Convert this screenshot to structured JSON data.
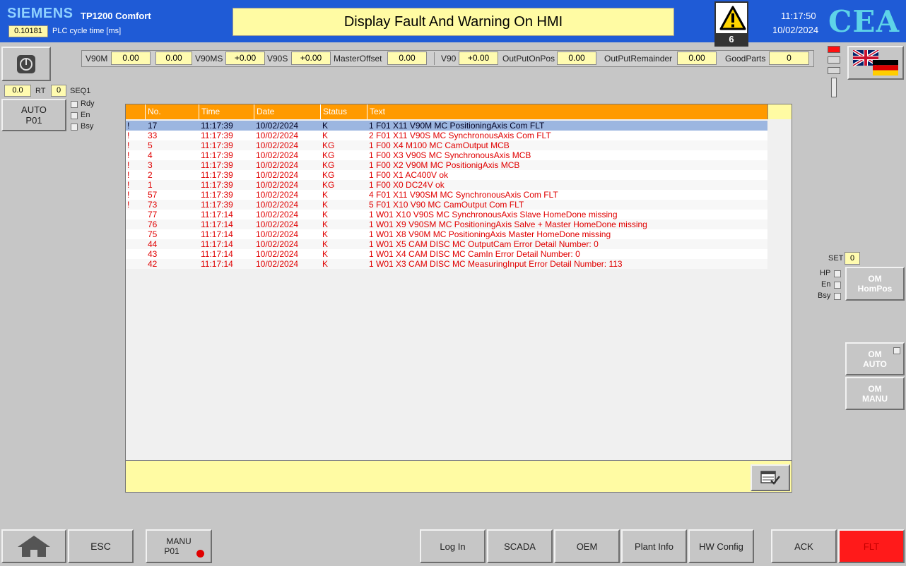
{
  "header": {
    "brand": "SIEMENS",
    "model": "TP1200 Comfort",
    "cycle_value": "0.10181",
    "cycle_label": "PLC cycle time [ms]",
    "title": "Display Fault And Warning On HMI",
    "warning_count": "6",
    "time": "11:17:50",
    "date": "10/02/2024",
    "logo": "CEA"
  },
  "left_panel": {
    "rt_value": "0.0",
    "rt_label": "RT",
    "seq_value": "0",
    "seq_label": "SEQ1",
    "auto_line1": "AUTO",
    "auto_line2": "P01",
    "rdy": "Rdy",
    "en": "En",
    "bsy": "Bsy"
  },
  "valbar": {
    "v90m_label": "V90M",
    "v90m_val1": "0.00",
    "v90m_val2": "0.00",
    "v90ms_label": "V90MS",
    "v90ms_val": "+0.00",
    "v90s_label": "V90S",
    "v90s_val": "+0.00",
    "master_offset_label": "MasterOffset",
    "master_offset_val": "0.00",
    "v90_label": "V90",
    "v90_val": "+0.00",
    "output_on_pos_label": "OutPutOnPos",
    "output_on_pos_val": "0.00",
    "output_remainder_label": "OutPutRemainder",
    "output_remainder_val": "0.00",
    "good_parts_label": "GoodParts",
    "good_parts_val": "0"
  },
  "alarm_table": {
    "columns": [
      "No.",
      "Time",
      "Date",
      "Status",
      "Text"
    ],
    "rows": [
      {
        "mark": "!",
        "no": "17",
        "time": "11:17:39",
        "date": "10/02/2024",
        "status": "K",
        "text": "1  F01  X11  V90M MC  PositioningAxis Com  FLT"
      },
      {
        "mark": "!",
        "no": "33",
        "time": "11:17:39",
        "date": "10/02/2024",
        "status": "K",
        "text": "2  F01  X11  V90S MC  SynchronousAxis Com  FLT"
      },
      {
        "mark": "!",
        "no": "5",
        "time": "11:17:39",
        "date": "10/02/2024",
        "status": "KG",
        "text": "1  F00  X4  M100  MC  CamOutput  MCB"
      },
      {
        "mark": "!",
        "no": "4",
        "time": "11:17:39",
        "date": "10/02/2024",
        "status": "KG",
        "text": "1  F00  X3  V90S  MC  SynchronousAxis MCB"
      },
      {
        "mark": "!",
        "no": "3",
        "time": "11:17:39",
        "date": "10/02/2024",
        "status": "KG",
        "text": "1  F00  X2  V90M  MC  PositionigAxis MCB"
      },
      {
        "mark": "!",
        "no": "2",
        "time": "11:17:39",
        "date": "10/02/2024",
        "status": "KG",
        "text": "1  F00  X1  AC400V  ok"
      },
      {
        "mark": "!",
        "no": "1",
        "time": "11:17:39",
        "date": "10/02/2024",
        "status": "KG",
        "text": "1  F00  X0  DC24V  ok"
      },
      {
        "mark": "!",
        "no": "57",
        "time": "11:17:39",
        "date": "10/02/2024",
        "status": "K",
        "text": "4  F01  X11  V90SM  MC  SynchronousAxis Com  FLT"
      },
      {
        "mark": "!",
        "no": "73",
        "time": "11:17:39",
        "date": "10/02/2024",
        "status": "K",
        "text": "5  F01  X10  V90  MC  CamOutput  Com  FLT"
      },
      {
        "mark": "",
        "no": "77",
        "time": "11:17:14",
        "date": "10/02/2024",
        "status": "K",
        "text": "1  W01  X10  V90S  MC  SynchronousAxis  Slave  HomeDone missing"
      },
      {
        "mark": "",
        "no": "76",
        "time": "11:17:14",
        "date": "10/02/2024",
        "status": "K",
        "text": "1  W01  X9  V90SM  MC  PositioningAxis Salve + Master HomeDone missing"
      },
      {
        "mark": "",
        "no": "75",
        "time": "11:17:14",
        "date": "10/02/2024",
        "status": "K",
        "text": "1  W01  X8  V90M  MC  PositioningAxis  Master  HomeDone missing"
      },
      {
        "mark": "",
        "no": "44",
        "time": "11:17:14",
        "date": "10/02/2024",
        "status": "K",
        "text": "1  W01  X5  CAM  DISC MC  OutputCam Error Detail Number: 0"
      },
      {
        "mark": "",
        "no": "43",
        "time": "11:17:14",
        "date": "10/02/2024",
        "status": "K",
        "text": "1  W01  X4  CAM  DISC MC  CamIn  Error Detail Number: 0"
      },
      {
        "mark": "",
        "no": "42",
        "time": "11:17:14",
        "date": "10/02/2024",
        "status": "K",
        "text": "1  W01  X3  CAM  DISC MC  MeasuringInput  Error Detail Number: 113"
      }
    ]
  },
  "right_panel": {
    "set_label": "SET",
    "set_value": "0",
    "hp": "HP",
    "en": "En",
    "bsy": "Bsy",
    "om_hompos_1": "OM",
    "om_hompos_2": "HomPos",
    "om_auto_1": "OM",
    "om_auto_2": "AUTO",
    "om_manu_1": "OM",
    "om_manu_2": "MANU"
  },
  "bottom_bar": {
    "esc": "ESC",
    "manu_1": "MANU",
    "manu_2": "P01",
    "login": "Log In",
    "scada": "SCADA",
    "oem": "OEM",
    "plant_info": "Plant Info",
    "hw_config": "HW Config",
    "ack": "ACK",
    "flt": "FLT"
  },
  "colors": {
    "header_bg": "#1f5bd6",
    "alarm_header": "#ff9a00",
    "alarm_text": "#e00000",
    "selected_row": "#9cb6e0",
    "flt_button": "#ff1a1a",
    "field_yellow": "#fffba3"
  }
}
